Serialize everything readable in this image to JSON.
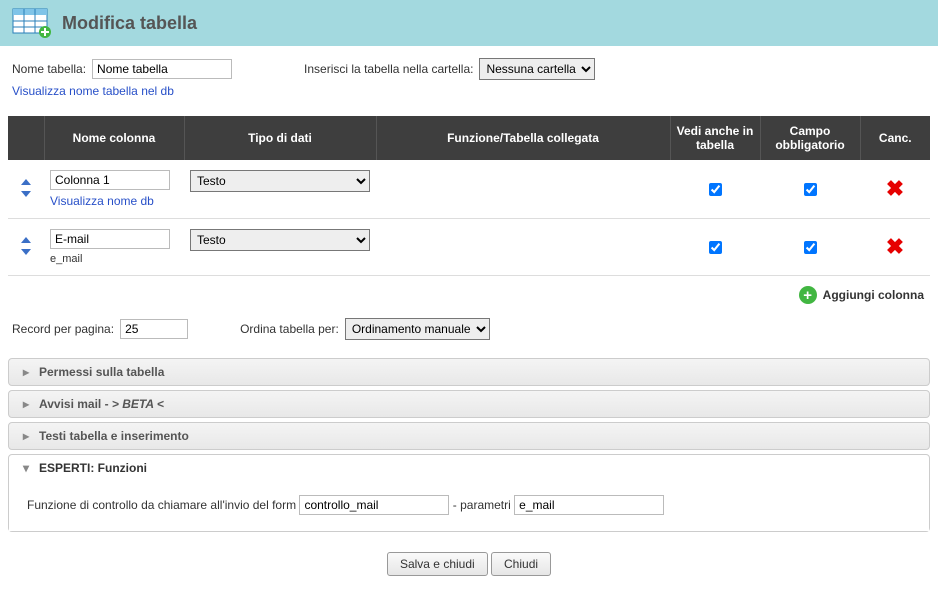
{
  "header": {
    "title": "Modifica tabella"
  },
  "top": {
    "nome_label": "Nome tabella:",
    "nome_value": "Nome tabella",
    "cartella_label": "Inserisci la tabella nella cartella:",
    "cartella_value": "Nessuna cartella",
    "visualizza_link": "Visualizza nome tabella nel db"
  },
  "table": {
    "headers": {
      "nome": "Nome colonna",
      "tipo": "Tipo di dati",
      "funzione": "Funzione/Tabella collegata",
      "vedi": "Vedi anche in tabella",
      "obbl": "Campo obbligatorio",
      "canc": "Canc."
    },
    "rows": [
      {
        "name": "Colonna 1",
        "sub_link": "Visualizza nome db",
        "sub_text": "",
        "type": "Testo",
        "vedi": true,
        "obbl": true
      },
      {
        "name": "E-mail",
        "sub_link": "",
        "sub_text": "e_mail",
        "type": "Testo",
        "vedi": true,
        "obbl": true
      }
    ]
  },
  "add_column_label": "Aggiungi colonna",
  "records": {
    "label": "Record per pagina:",
    "value": "25",
    "ordina_label": "Ordina tabella per:",
    "ordina_value": "Ordinamento manuale"
  },
  "accordion": {
    "permessi": "Permessi sulla tabella",
    "avvisi_prefix": "Avvisi mail - ",
    "avvisi_beta": "> BETA <",
    "testi": "Testi tabella e inserimento",
    "esperti": "ESPERTI: Funzioni"
  },
  "esperti": {
    "funzione_label": "Funzione di controllo da chiamare all'invio del form",
    "funzione_value": "controllo_mail",
    "param_label": "- parametri",
    "param_value": "e_mail"
  },
  "buttons": {
    "save": "Salva e chiudi",
    "close": "Chiudi"
  }
}
